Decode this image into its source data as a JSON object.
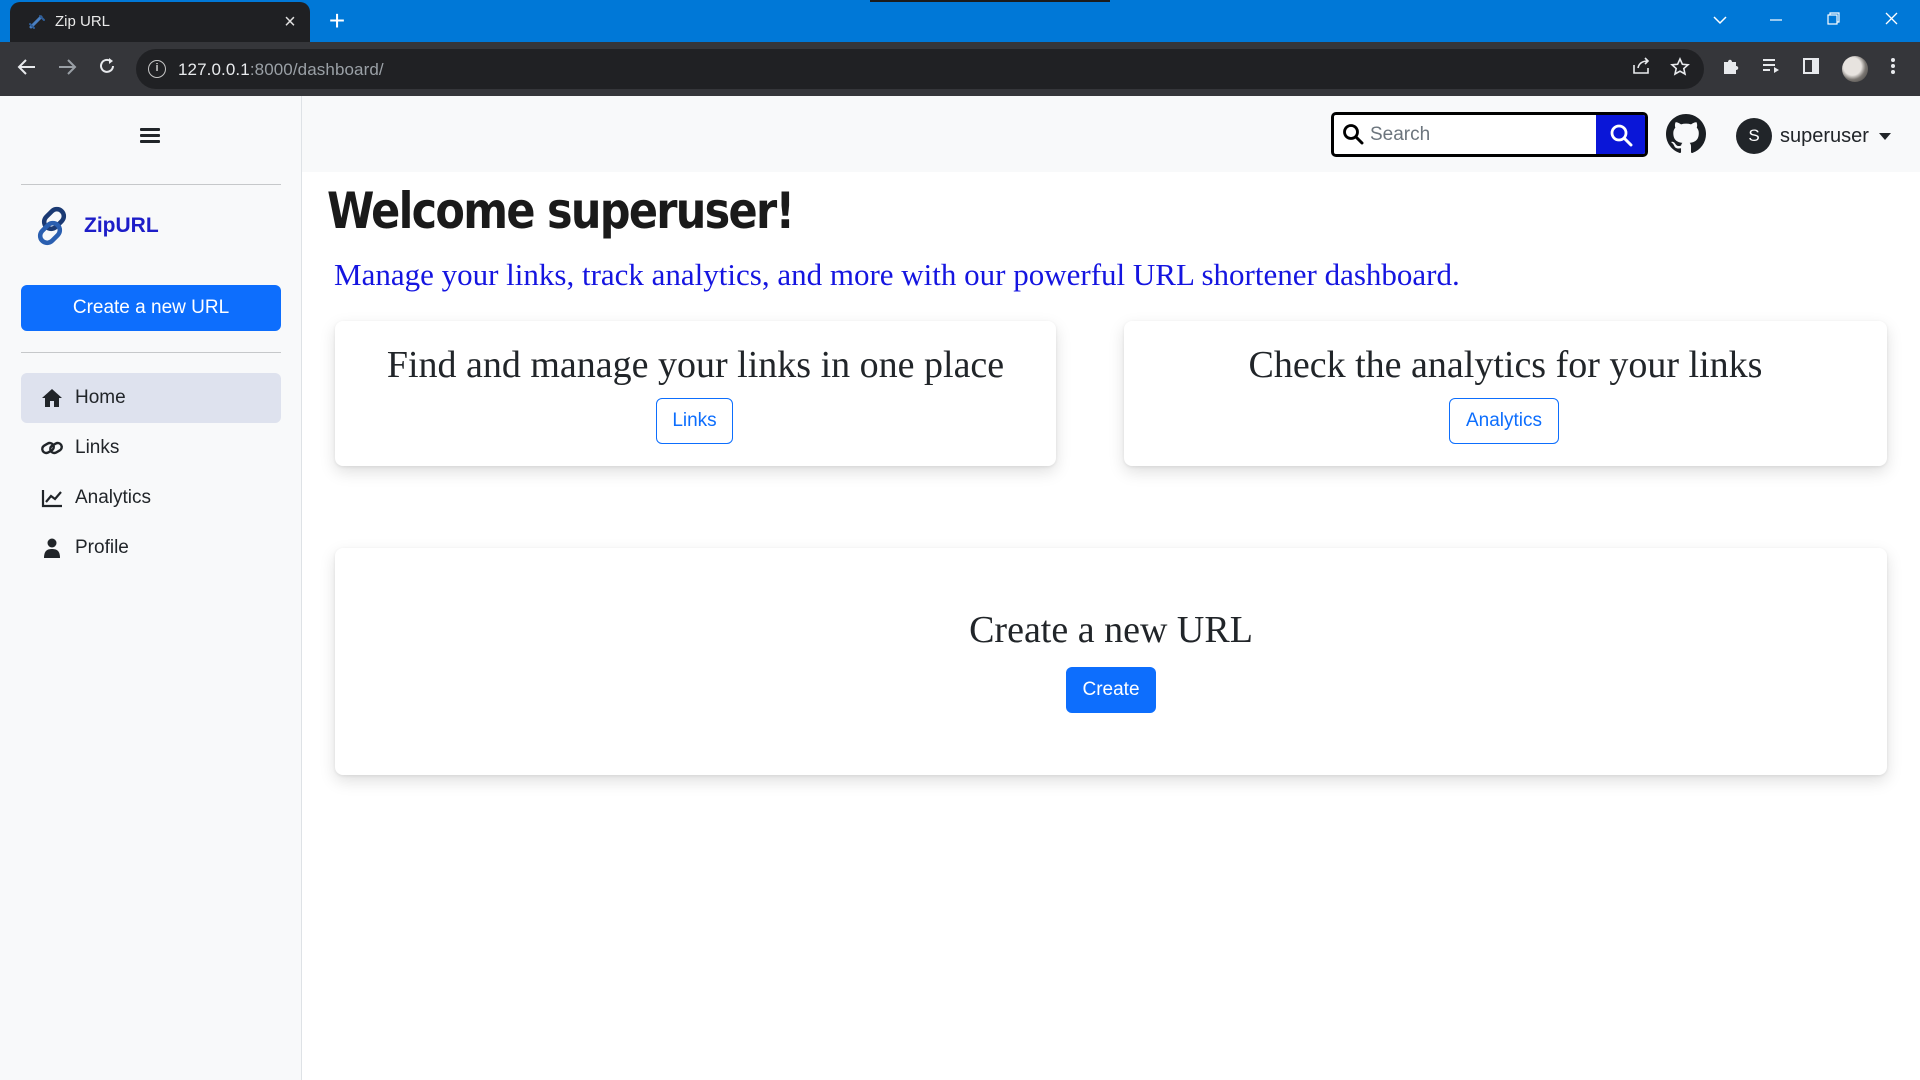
{
  "browser": {
    "tab_title": "Zip URL",
    "url_host": "127.0.0.1",
    "url_path": ":8000/dashboard/"
  },
  "sidebar": {
    "brand": "ZipURL",
    "create_button": "Create a new URL",
    "items": [
      {
        "label": "Home",
        "icon": "home-icon",
        "active": true
      },
      {
        "label": "Links",
        "icon": "link-icon",
        "active": false
      },
      {
        "label": "Analytics",
        "icon": "chart-icon",
        "active": false
      },
      {
        "label": "Profile",
        "icon": "user-icon",
        "active": false
      }
    ]
  },
  "header": {
    "search_placeholder": "Search",
    "avatar_initial": "S",
    "username": "superuser"
  },
  "main": {
    "welcome": "Welcome superuser!",
    "subtitle": "Manage your links, track analytics, and more with our powerful URL shortener dashboard.",
    "cards": [
      {
        "title": "Find and manage your links in one place",
        "button": "Links"
      },
      {
        "title": "Check the analytics for your links",
        "button": "Analytics"
      }
    ],
    "create_card": {
      "title": "Create a new URL",
      "button": "Create"
    }
  },
  "colors": {
    "accent": "#0d6efd",
    "brand": "#1d1dc8",
    "subtitle": "#1515e0",
    "search_button": "#0a16d8",
    "browser_frame": "#0078d7"
  }
}
